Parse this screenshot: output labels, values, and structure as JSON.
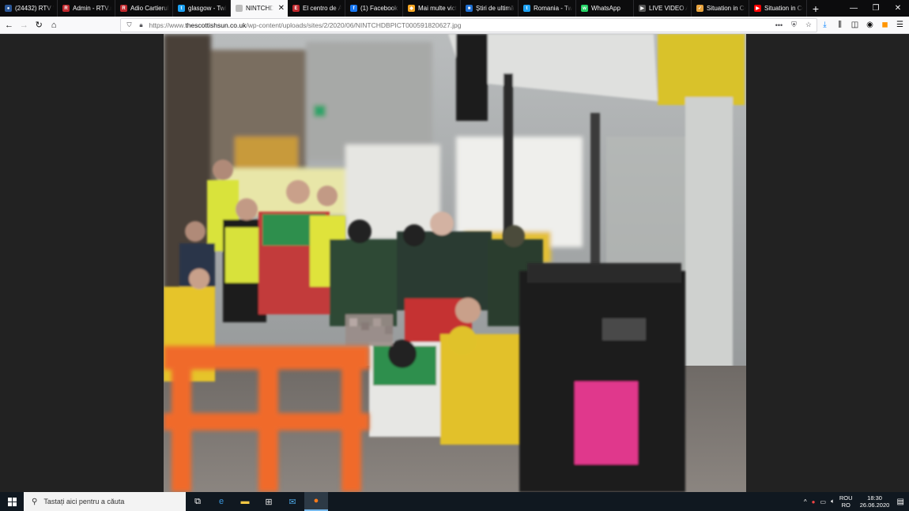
{
  "tabs": [
    {
      "label": "(24432) RTV We",
      "icon": "rtv-icon",
      "color": "#2b5797",
      "glyph": "●",
      "active": false
    },
    {
      "label": "Admin - RTV.ro",
      "icon": "rtv-admin-icon",
      "color": "#c0282d",
      "glyph": "R",
      "active": false
    },
    {
      "label": "Adio Cartierul",
      "icon": "rtv-icon",
      "color": "#c0282d",
      "glyph": "R",
      "active": false
    },
    {
      "label": "glasgow - Twitt",
      "icon": "twitter-icon",
      "color": "#1da1f2",
      "glyph": "t",
      "active": false
    },
    {
      "label": "NINTCHDBPICT",
      "icon": "image-icon",
      "color": "#bdbdbd",
      "glyph": "",
      "active": true
    },
    {
      "label": "El centro de Á",
      "icon": "news-icon",
      "color": "#c0282d",
      "glyph": "E",
      "active": false
    },
    {
      "label": "(1) Facebook",
      "icon": "facebook-icon",
      "color": "#1877f2",
      "glyph": "f",
      "active": false
    },
    {
      "label": "Mai multe victi",
      "icon": "news-icon",
      "color": "#f5a623",
      "glyph": "◆",
      "active": false
    },
    {
      "label": "Știri de ultimă",
      "icon": "news-icon",
      "color": "#1f6fd1",
      "glyph": "■",
      "active": false
    },
    {
      "label": "Romania - Twit",
      "icon": "twitter-icon",
      "color": "#1da1f2",
      "glyph": "t",
      "active": false
    },
    {
      "label": "WhatsApp",
      "icon": "whatsapp-icon",
      "color": "#25d366",
      "glyph": "w",
      "active": false
    },
    {
      "label": "LIVE VIDEO AU",
      "icon": "video-icon",
      "color": "#555555",
      "glyph": "▶",
      "active": false
    },
    {
      "label": "Situation in Ce",
      "icon": "news-icon",
      "color": "#e8a33d",
      "glyph": "✓",
      "active": false
    },
    {
      "label": "Situation in Ce",
      "icon": "youtube-icon",
      "color": "#ff0000",
      "glyph": "▶",
      "active": false
    }
  ],
  "new_tab_label": "+",
  "window": {
    "minimize": "—",
    "restore": "❐",
    "close": "✕"
  },
  "nav": {
    "back": "←",
    "forward": "→",
    "reload": "↻",
    "home": "⌂"
  },
  "url": {
    "prefix": "https://www.",
    "domain": "thescottishsun.co.uk",
    "path": "/wp-content/uploads/sites/2/2020/06/NINTCHDBPICT000591820627.jpg",
    "more": "•••"
  },
  "taskbar": {
    "search_placeholder": "Tastați aici pentru a căuta",
    "lang_top": "ROU",
    "lang_bottom": "RO",
    "time": "18:30",
    "date": "26.06.2020"
  },
  "colors": {
    "tab_bg": "#0c0c0d",
    "navbar_bg": "#f9f9fa",
    "taskbar_bg": "#101820",
    "content_bg": "#222222"
  }
}
